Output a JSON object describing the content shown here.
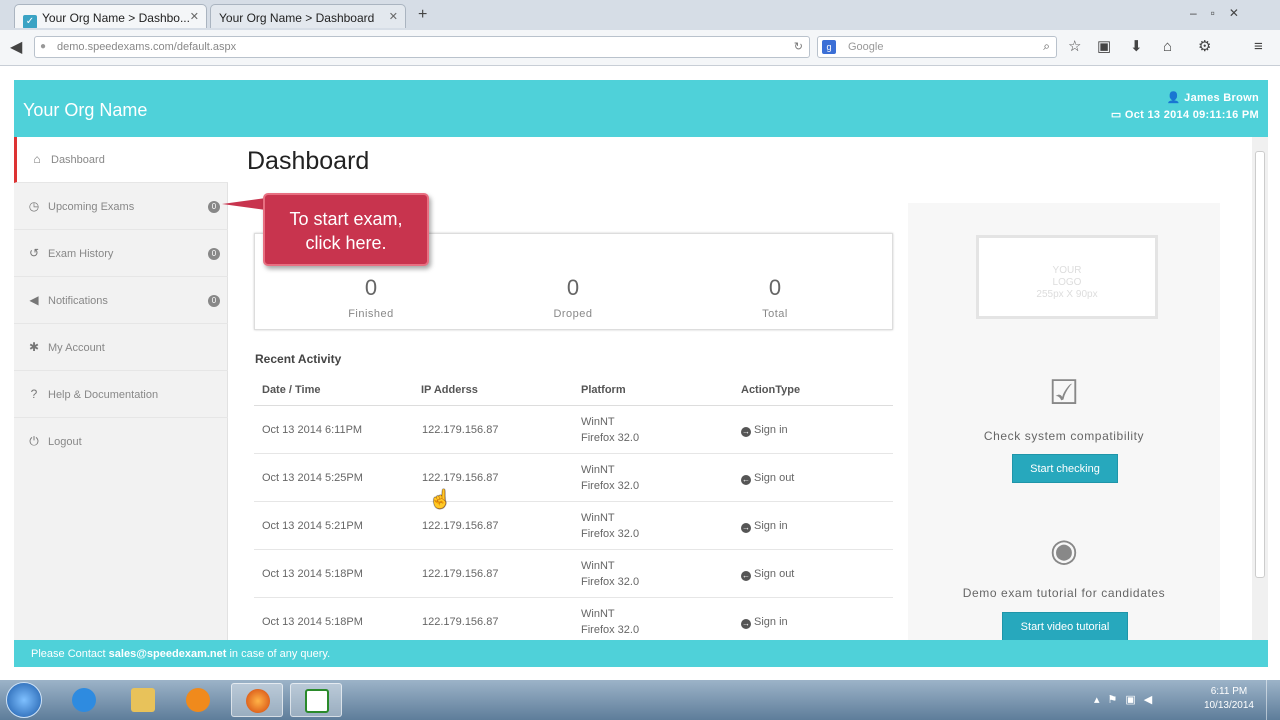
{
  "browser": {
    "tabs": [
      {
        "title": "Your Org Name > Dashbo...",
        "close": "✕"
      },
      {
        "title": "Your Org Name > Dashboard",
        "close": "✕"
      }
    ],
    "new_tab": "+",
    "url": "demo.speedexams.com/default.aspx",
    "search_placeholder": "Google"
  },
  "header": {
    "org_name": "Your Org Name",
    "user_name": "James Brown",
    "datetime": "Oct 13 2014   09:11:16 PM"
  },
  "sidebar": {
    "items": [
      {
        "label": "Dashboard",
        "icon": "home-icon",
        "glyph": "⌂"
      },
      {
        "label": "Upcoming Exams",
        "icon": "clock-icon",
        "glyph": "◷",
        "badge": "0"
      },
      {
        "label": "Exam History",
        "icon": "history-icon",
        "glyph": "↺",
        "badge": "0"
      },
      {
        "label": "Notifications",
        "icon": "bullhorn-icon",
        "glyph": "◀",
        "badge": "0"
      },
      {
        "label": "My Account",
        "icon": "gear-icon",
        "glyph": "✱"
      },
      {
        "label": "Help & Documentation",
        "icon": "help-icon",
        "glyph": "?"
      },
      {
        "label": "Logout",
        "icon": "power-icon",
        "glyph": "⏻"
      }
    ]
  },
  "main": {
    "title": "Dashboard",
    "stats": [
      {
        "value": "0",
        "label": "Finished"
      },
      {
        "value": "0",
        "label": "Droped"
      },
      {
        "value": "0",
        "label": "Total"
      }
    ],
    "recent_activity_title": "Recent Activity",
    "columns": [
      "Date / Time",
      "IP Adderss",
      "Platform",
      "ActionType"
    ],
    "rows": [
      {
        "datetime": "Oct 13 2014 6:11PM",
        "ip": "122.179.156.87",
        "os": "WinNT",
        "browser": "Firefox 32.0",
        "action": "Sign in",
        "action_icon": "signin-icon"
      },
      {
        "datetime": "Oct 13 2014 5:25PM",
        "ip": "122.179.156.87",
        "os": "WinNT",
        "browser": "Firefox 32.0",
        "action": "Sign out",
        "action_icon": "signout-icon"
      },
      {
        "datetime": "Oct 13 2014 5:21PM",
        "ip": "122.179.156.87",
        "os": "WinNT",
        "browser": "Firefox 32.0",
        "action": "Sign in",
        "action_icon": "signin-icon"
      },
      {
        "datetime": "Oct 13 2014 5:18PM",
        "ip": "122.179.156.87",
        "os": "WinNT",
        "browser": "Firefox 32.0",
        "action": "Sign out",
        "action_icon": "signout-icon"
      },
      {
        "datetime": "Oct 13 2014 5:18PM",
        "ip": "122.179.156.87",
        "os": "WinNT",
        "browser": "Firefox 32.0",
        "action": "Sign in",
        "action_icon": "signin-icon"
      }
    ]
  },
  "right_panel": {
    "logo_text": [
      "YOUR",
      "LOGO",
      "255px X 90px"
    ],
    "check_text": "Check system compatibility",
    "check_button": "Start checking",
    "demo_text": "Demo exam tutorial for candidates",
    "demo_button": "Start video tutorial"
  },
  "callout": {
    "line1": "To start exam,",
    "line2": "click here."
  },
  "footer": {
    "prefix": "Please Contact",
    "email": "sales@speedexam.net",
    "suffix": "in case of any query."
  },
  "taskbar": {
    "time": "6:11 PM",
    "date": "10/13/2014"
  },
  "colors": {
    "header": "#4fd1d9",
    "active_marker": "#dd3333",
    "button": "#27a8bd",
    "callout": "#c8344e"
  }
}
